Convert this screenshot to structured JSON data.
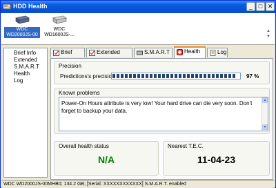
{
  "window": {
    "title": "HDD Health"
  },
  "title_buttons": {
    "minimize": "_",
    "maximize": "□",
    "close": "✕"
  },
  "drives": [
    {
      "label_line1": "WDC",
      "label_line2": "WD2000JS-00",
      "selected": true
    },
    {
      "label_line1": "WDC",
      "label_line2": "WD1600JS-...",
      "selected": false
    }
  ],
  "sidebar": {
    "items": [
      "Brief Info",
      "Extended",
      "S.M.A.R.T",
      "Health",
      "Log"
    ]
  },
  "tabs": [
    {
      "label": "Brief Info",
      "icon": "checkbox-icon"
    },
    {
      "label": "Extended Info",
      "icon": "checkbox-icon"
    },
    {
      "label": "S.M.A.R.T",
      "icon": "drive-icon"
    },
    {
      "label": "Health",
      "icon": "health-icon",
      "active": true
    },
    {
      "label": "Log",
      "icon": "log-icon"
    }
  ],
  "precision": {
    "group_label": "Precision",
    "label": "Predictions's precision",
    "value_text": "97 %",
    "value": 0.97
  },
  "problems": {
    "group_label": "Known problems",
    "text": "Power-On Hours attribute is very low! Your hard drive can die very soon. Don't forget to backup your data."
  },
  "health": {
    "group_label": "Overall health status",
    "value": "N/A",
    "color": "#008000"
  },
  "tec": {
    "group_label": "Nearest T.E.C.",
    "value": "11-04-23"
  },
  "statusbar": {
    "text": "WDC WD2000JS-00MHB0;  134.2 GB;  [Serial: XXXXXXXXXXXX]  S.M.A.R.T. enabled"
  }
}
